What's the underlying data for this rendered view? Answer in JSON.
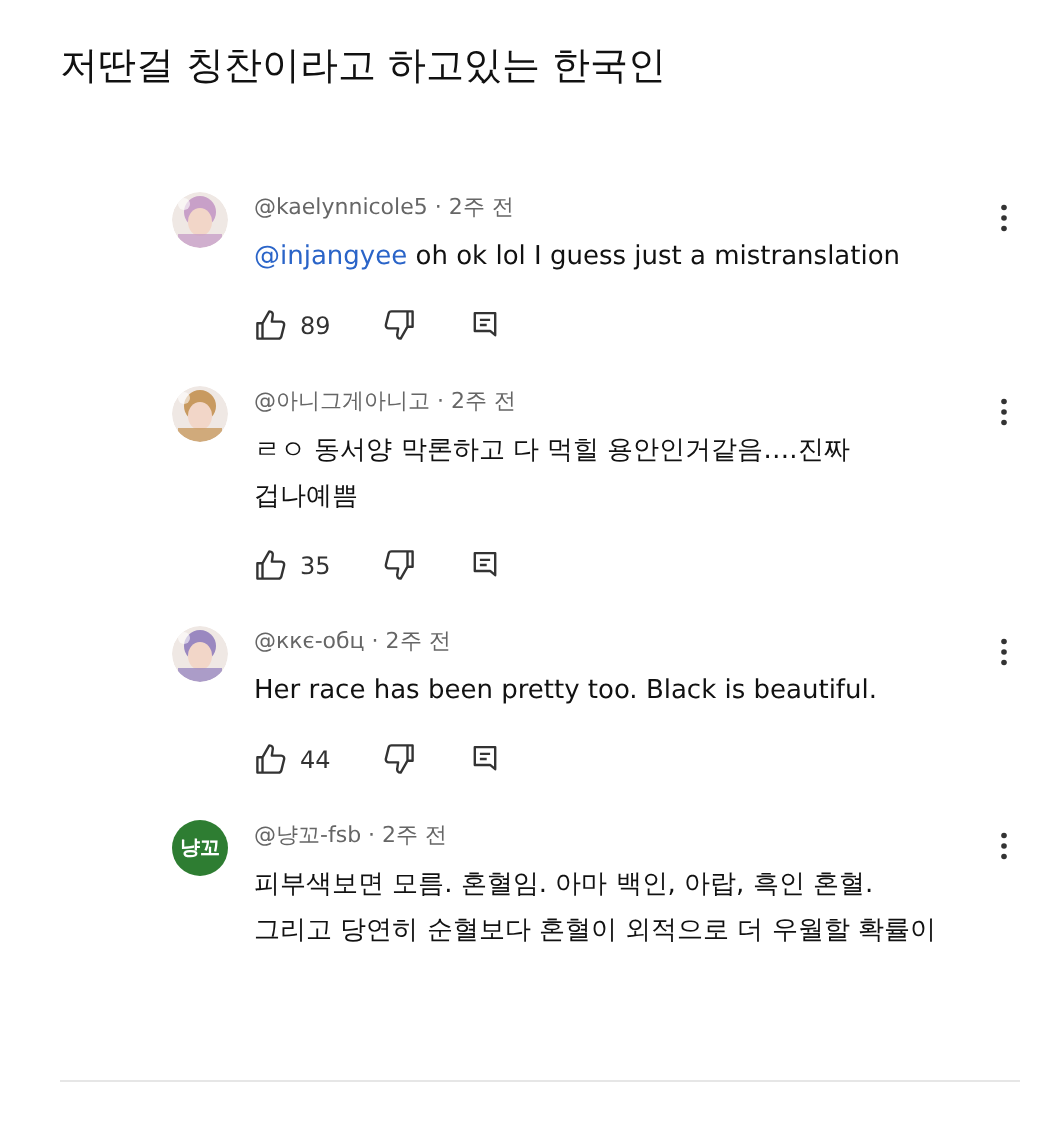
{
  "title": "저딴걸 칭찬이라고 하고있는 한국인",
  "comments": [
    {
      "avatar": {
        "kind": "picture"
      },
      "byline": "@kaelynnicole5 · 2주 전",
      "mention": "@injangyee",
      "lines": [
        "oh ok lol I guess just a mistranslation"
      ],
      "likes": "89"
    },
    {
      "avatar": {
        "kind": "picture"
      },
      "byline": "@아니그게아니고 · 2주 전",
      "lines": [
        "ㄹㅇ 동서양 막론하고 다 먹힐 용안인거같음….진짜",
        "겁나예쁨"
      ],
      "likes": "35"
    },
    {
      "avatar": {
        "kind": "picture"
      },
      "byline": "@ккє-обц · 2주 전",
      "lines": [
        "Her race has been pretty too. Black is beautiful."
      ],
      "likes": "44"
    },
    {
      "avatar": {
        "kind": "text",
        "text": "냥꼬",
        "color": "#2e7d32"
      },
      "byline": "@냥꼬-fsb · 2주 전",
      "lines": [
        "피부색보면 모름. 혼혈임. 아마 백인, 아랍, 흑인 혼혈.",
        "그리고 당연히 순혈보다 혼혈이 외적으로 더 우월할 확률이"
      ]
    }
  ]
}
